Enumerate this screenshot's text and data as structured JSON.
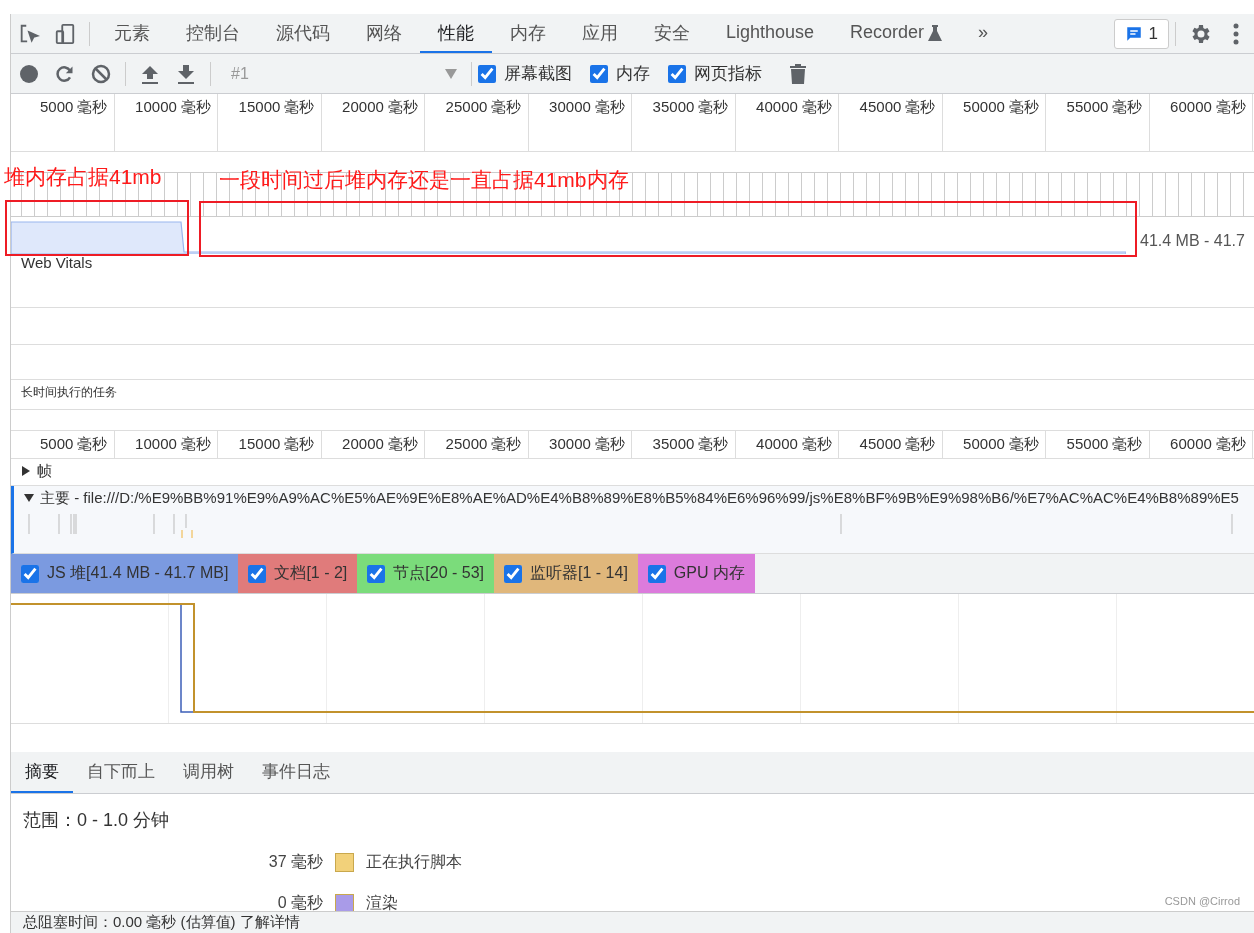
{
  "main_tabs": [
    {
      "label": "元素",
      "selected": false
    },
    {
      "label": "控制台",
      "selected": false
    },
    {
      "label": "源代码",
      "selected": false
    },
    {
      "label": "网络",
      "selected": false
    },
    {
      "label": "性能",
      "selected": true
    },
    {
      "label": "内存",
      "selected": false
    },
    {
      "label": "应用",
      "selected": false
    },
    {
      "label": "安全",
      "selected": false
    },
    {
      "label": "Lighthouse",
      "selected": false
    },
    {
      "label": "Recorder",
      "selected": false,
      "experimental": true
    }
  ],
  "overflow_tabs": "»",
  "issues_count": "1",
  "toolbar": {
    "profile": "#1",
    "options": [
      {
        "label": "屏幕截图",
        "checked": true
      },
      {
        "label": "内存",
        "checked": true
      },
      {
        "label": "网页指标",
        "checked": true
      }
    ]
  },
  "overview": {
    "ruler": [
      "5000 毫秒",
      "10000 毫秒",
      "15000 毫秒",
      "20000 毫秒",
      "25000 毫秒",
      "30000 毫秒",
      "35000 毫秒",
      "40000 毫秒",
      "45000 毫秒",
      "50000 毫秒",
      "55000 毫秒",
      "60000 毫秒"
    ],
    "memory_range": "41.4 MB - 41.7",
    "web_vitals": "Web Vitals",
    "long_tasks": "长时间执行的任务"
  },
  "annotations": [
    {
      "text": "堆内存占据41mb"
    },
    {
      "text": "一段时间过后堆内存还是一直占据41mb内存"
    }
  ],
  "timeline": {
    "ruler": [
      "5000 毫秒",
      "10000 毫秒",
      "15000 毫秒",
      "20000 毫秒",
      "25000 毫秒",
      "30000 毫秒",
      "35000 毫秒",
      "40000 毫秒",
      "45000 毫秒",
      "50000 毫秒",
      "55000 毫秒",
      "60000 毫秒"
    ],
    "tracks": [
      {
        "label": "帧",
        "expanded": false
      },
      {
        "label": "主要 - file:///D:/%E9%BB%91%E9%A9%AC%E5%AE%9E%E8%AE%AD%E4%B8%89%E8%B5%84%E6%96%99/js%E8%BF%9B%E9%98%B6/%E7%AC%AC%E4%B8%89%E5",
        "expanded": true
      }
    ]
  },
  "counters": [
    {
      "label": "JS 堆[41.4 MB - 41.7 MB]",
      "checked": true,
      "color": "#7b9ae0"
    },
    {
      "label": "文档[1 - 2]",
      "checked": true,
      "color": "#e07b7b"
    },
    {
      "label": "节点[20 - 53]",
      "checked": true,
      "color": "#7bdc7b"
    },
    {
      "label": "监听器[1 - 14]",
      "checked": true,
      "color": "#e0b77b"
    },
    {
      "label": "GPU 内存",
      "checked": true,
      "color": "#dc7bdc"
    }
  ],
  "detail_tabs": [
    {
      "label": "摘要",
      "selected": true
    },
    {
      "label": "自下而上",
      "selected": false
    },
    {
      "label": "调用树",
      "selected": false
    },
    {
      "label": "事件日志",
      "selected": false
    }
  ],
  "summary": {
    "range": "范围：0 - 1.0 分钟",
    "legend": [
      {
        "time": "37 毫秒",
        "label": "正在执行脚本",
        "color": "#f2d17a"
      },
      {
        "time": "0 毫秒",
        "label": "渲染",
        "color": "#a99be8"
      }
    ]
  },
  "footer": "总阻塞时间：0.00 毫秒 (估算值) 了解详情",
  "watermark_credit": "CSDN @Cirrod"
}
